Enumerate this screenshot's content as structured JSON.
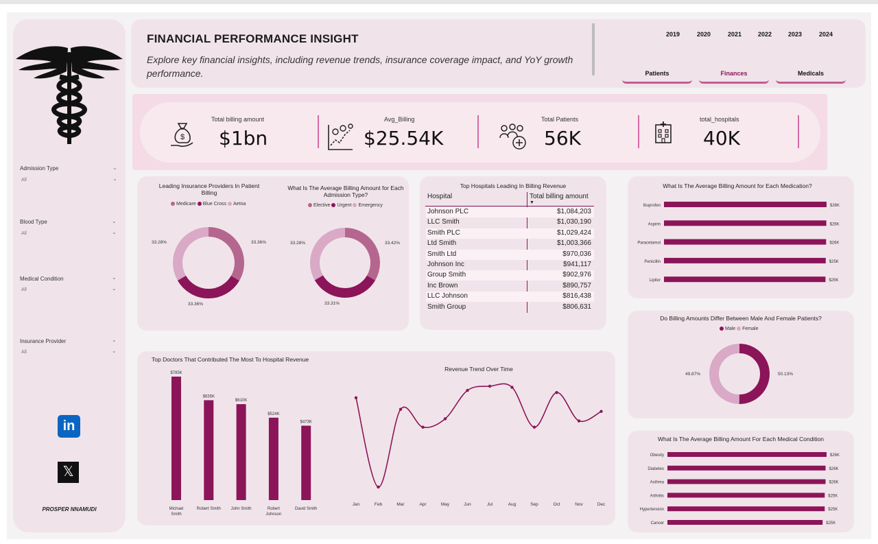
{
  "header": {
    "title": "FINANCIAL PERFORMANCE INSIGHT",
    "subtitle": "Explore key financial insights, including revenue trends, insurance coverage impact, and YoY growth performance.",
    "years": [
      "2019",
      "2020",
      "2021",
      "2022",
      "2023",
      "2024"
    ],
    "tabs": [
      "Patients",
      "Finances",
      "Medicals"
    ],
    "active_tab": "Finances"
  },
  "sidebar": {
    "filters": [
      {
        "label": "Admission Type",
        "value": "All"
      },
      {
        "label": "Blood Type",
        "value": "All"
      },
      {
        "label": "Medical Condition",
        "value": "All"
      },
      {
        "label": "Insurance Provider",
        "value": "All"
      }
    ],
    "social": {
      "linkedin": "in",
      "x": "𝕏"
    },
    "author": "PROSPER NNAMUDI"
  },
  "kpis": [
    {
      "label": "Total billing amount",
      "value": "$1bn",
      "icon": "money-bag-icon"
    },
    {
      "label": "Avg_Billing",
      "value": "$25.54K",
      "icon": "growth-chart-icon"
    },
    {
      "label": "Total Patients",
      "value": "56K",
      "icon": "patients-icon"
    },
    {
      "label": "total_hospitals",
      "value": "40K",
      "icon": "hospital-icon"
    }
  ],
  "colors": {
    "accent": "#8b1558",
    "mid": "#b5668f",
    "light": "#d9a9c6",
    "panel": "#f0e4ea"
  },
  "chart_data": [
    {
      "id": "insurance",
      "type": "pie",
      "title": "Leading Insurance Providers In Patient Billing",
      "categories": [
        "Medicare",
        "Blue Cross",
        "Aetna"
      ],
      "values": [
        33.36,
        33.36,
        33.28
      ],
      "labels": [
        "33.36%",
        "33.36%",
        "33.28%"
      ]
    },
    {
      "id": "admission",
      "type": "pie",
      "title": "What Is The Average Billing Amount for Each Admission Type?",
      "categories": [
        "Elective",
        "Urgent",
        "Emergency"
      ],
      "values": [
        33.42,
        33.31,
        33.28
      ],
      "labels": [
        "33.42%",
        "33.31%",
        "33.28%"
      ]
    },
    {
      "id": "hospitals",
      "type": "table",
      "title": "Top Hospitals Leading In Billing Revenue",
      "columns": [
        "Hospital",
        "Total billing amount"
      ],
      "rows": [
        [
          "Johnson PLC",
          "$1,084,203"
        ],
        [
          "LLC Smith",
          "$1,030,190"
        ],
        [
          "Smith PLC",
          "$1,029,424"
        ],
        [
          "Ltd Smith",
          "$1,003,366"
        ],
        [
          "Smith Ltd",
          "$970,036"
        ],
        [
          "Johnson Inc",
          "$941,117"
        ],
        [
          "Group Smith",
          "$902,976"
        ],
        [
          "Inc Brown",
          "$890,757"
        ],
        [
          "LLC Johnson",
          "$816,438"
        ],
        [
          "Smith Group",
          "$806,631"
        ]
      ]
    },
    {
      "id": "medication",
      "type": "bar",
      "title": "What Is The Average Billing Amount for Each Medication?",
      "categories": [
        "Ibuprofen",
        "Aspirin",
        "Paracetamol",
        "Penicillin",
        "Lipitor"
      ],
      "values": [
        25.62,
        25.58,
        25.55,
        25.49,
        25.45
      ],
      "labels": [
        "$26K",
        "$26K",
        "$26K",
        "$25K",
        "$25K"
      ]
    },
    {
      "id": "gender",
      "type": "pie",
      "title": "Do Billing Amounts Differ Between Male And Female Patients?",
      "categories": [
        "Male",
        "Female"
      ],
      "values": [
        50.13,
        49.87
      ],
      "labels": [
        "50.13%",
        "49.87%"
      ]
    },
    {
      "id": "doctors",
      "type": "bar",
      "title": "Top Doctors That Contributed The Most To Hospital Revenue",
      "categories": [
        "Michael Smith",
        "Robert Smith",
        "John Smith",
        "Robert Johnson",
        "David Smith"
      ],
      "values": [
        785,
        635,
        610,
        524,
        473
      ],
      "labels": [
        "$785K",
        "$635K",
        "$610K",
        "$524K",
        "$473K"
      ]
    },
    {
      "id": "trend",
      "type": "line",
      "title": "Revenue Trend Over Time",
      "categories": [
        "Jan",
        "Feb",
        "Mar",
        "Apr",
        "May",
        "Jun",
        "Jul",
        "Aug",
        "Sep",
        "Oct",
        "Nov",
        "Dec"
      ],
      "values": [
        115.5,
        107.0,
        114.4,
        112.7,
        113.5,
        116.2,
        116.6,
        116.5,
        112.7,
        116.0,
        113.3,
        114.2
      ]
    },
    {
      "id": "condition",
      "type": "bar",
      "title": "What Is The Average Billing Amount For Each Medical Condition",
      "categories": [
        "Obesity",
        "Diabetes",
        "Asthma",
        "Arthritis",
        "Hypertension",
        "Cancer"
      ],
      "values": [
        25.8,
        25.64,
        25.64,
        25.5,
        25.5,
        25.16
      ],
      "labels": [
        "$26K",
        "$26K",
        "$26K",
        "$25K",
        "$25K",
        "$25K"
      ]
    }
  ]
}
